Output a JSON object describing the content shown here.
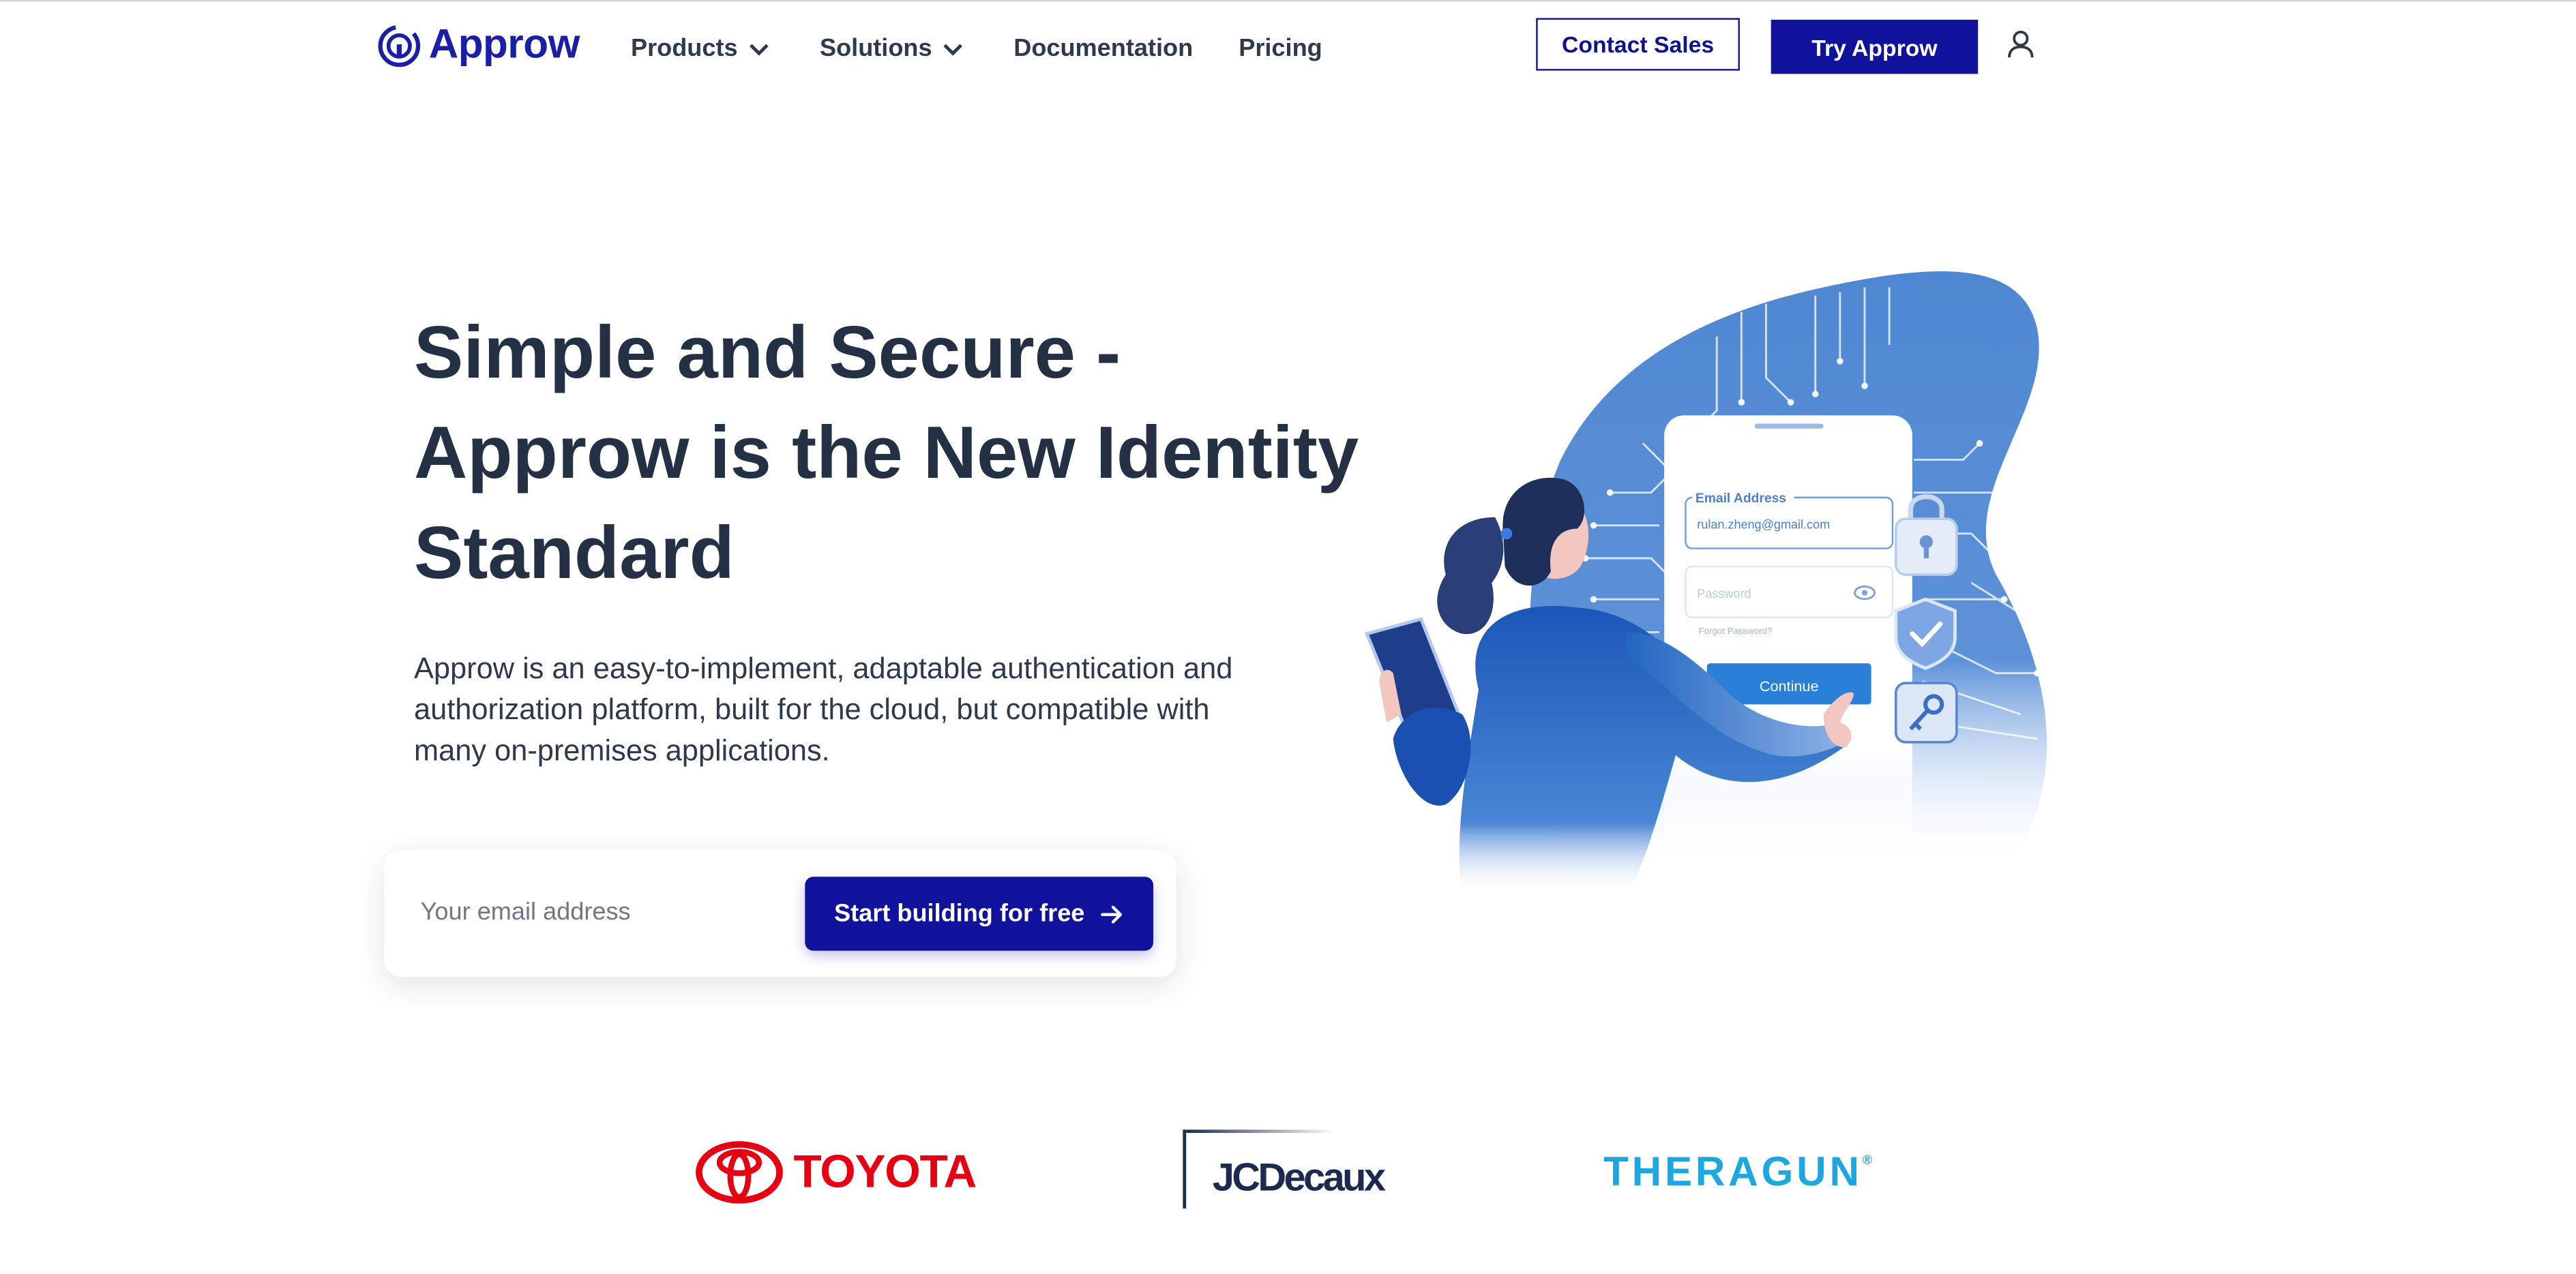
{
  "brand": {
    "name": "Approw",
    "color": "#1a1fa6"
  },
  "nav": {
    "items": [
      {
        "label": "Products",
        "dropdown": true
      },
      {
        "label": "Solutions",
        "dropdown": true
      },
      {
        "label": "Documentation",
        "dropdown": false
      },
      {
        "label": "Pricing",
        "dropdown": false
      }
    ],
    "contact_label": "Contact Sales",
    "try_label": "Try Approw",
    "user_icon": "user-icon"
  },
  "hero": {
    "title_lines": [
      "Simple and Secure -",
      "Approw is the New Identity",
      "Standard"
    ],
    "description": "Approw is an easy-to-implement, adaptable authentication and authorization platform, built for the cloud, but compatible with many on-premises applications.",
    "email_placeholder": "Your email address",
    "email_value": "",
    "cta_label": "Start building for free",
    "accent_color": "#11129b"
  },
  "illustration": {
    "form_email_label": "Email Address",
    "form_email_value": "rulan.zheng@gmail.com",
    "form_password_placeholder": "Password",
    "form_forgot_label": "Forgot Password?",
    "form_continue_label": "Continue"
  },
  "customer_logos": [
    {
      "name": "TOYOTA",
      "color": "#e60012"
    },
    {
      "name": "JCDecaux",
      "color": "#1b2a4e"
    },
    {
      "name": "THERAGUN",
      "mark": "®",
      "color": "#1ca7e0"
    }
  ]
}
